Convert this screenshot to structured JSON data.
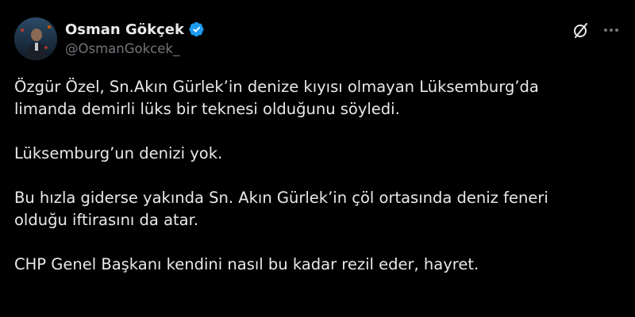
{
  "author": {
    "display_name": "Osman Gökçek",
    "handle": "@OsmanGokcek_",
    "verified": true,
    "verified_color": "#1d9bf0"
  },
  "actions": {
    "grok_icon": "grok-slash-circle-icon",
    "more_icon": "more-horizontal-icon"
  },
  "tweet": {
    "paragraphs": [
      [
        "Özgür Özel, Sn.Akın Gürlek’in denize kıyısı olmayan Lüksemburg’da",
        "limanda demirli lüks bir teknesi olduğunu söyledi."
      ],
      [
        "Lüksemburg’un denizi yok."
      ],
      [
        "Bu hızla giderse yakında Sn. Akın Gürlek’in çöl ortasında deniz feneri",
        "olduğu iftirasını da atar."
      ],
      [
        "CHP Genel Başkanı kendini nasıl bu kadar rezil eder, hayret."
      ]
    ]
  },
  "colors": {
    "background": "#000000",
    "text_primary": "#e7e9ea",
    "text_secondary": "#71767b"
  }
}
